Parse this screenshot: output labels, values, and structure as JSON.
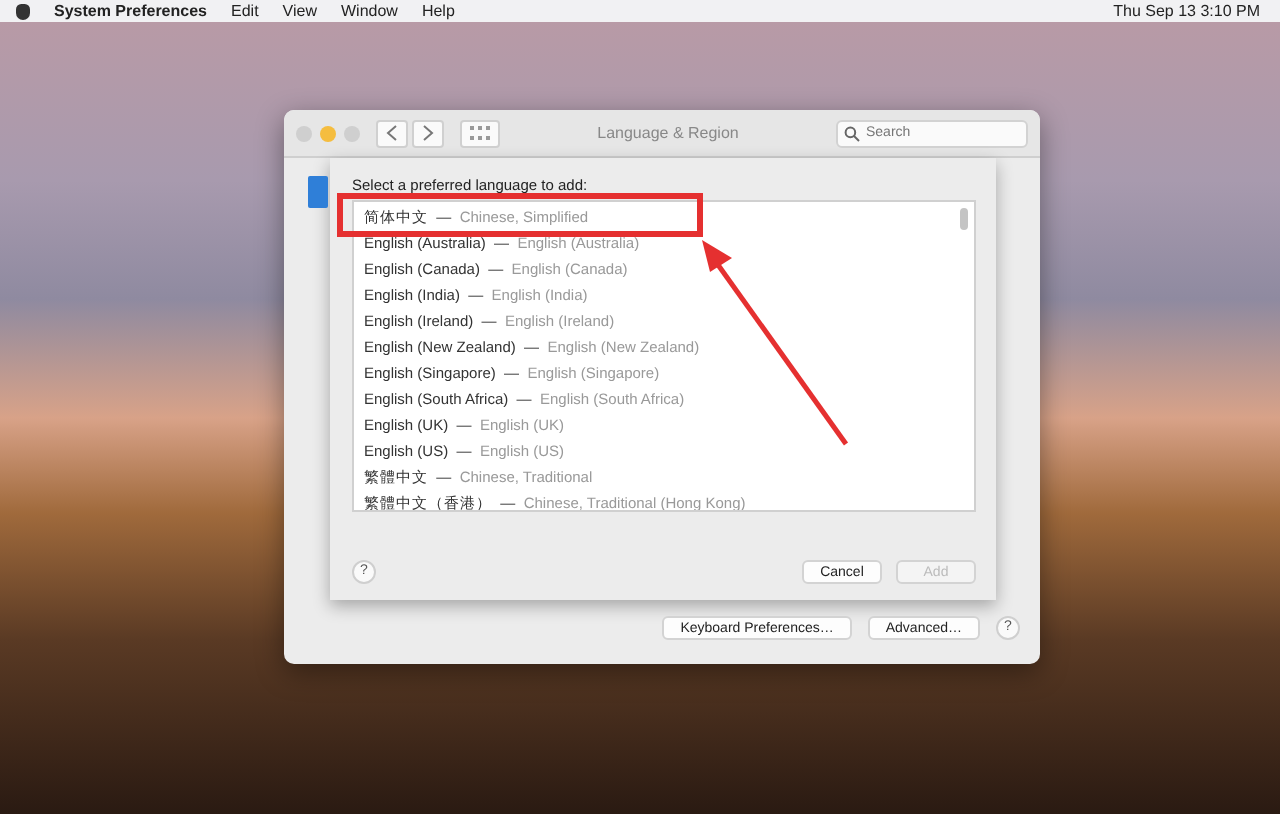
{
  "menu_bar": {
    "items": [
      {
        "label": "System Preferences",
        "kind": "app"
      },
      {
        "label": "Edit",
        "kind": "menu"
      },
      {
        "label": "View",
        "kind": "menu"
      },
      {
        "label": "Window",
        "kind": "menu"
      },
      {
        "label": "Help",
        "kind": "menu"
      }
    ],
    "clock": "Thu Sep 13  3:10 PM"
  },
  "window": {
    "title": "Language & Region",
    "search": {
      "placeholder": "Search"
    },
    "sheet": {
      "prompt": "Select a preferred language to add:",
      "languages": [
        {
          "native": "简体中文",
          "separator": "—",
          "english": "Chinese, Simplified"
        },
        {
          "native": "English (Australia)",
          "separator": "—",
          "english": "English (Australia)"
        },
        {
          "native": "English (Canada)",
          "separator": "—",
          "english": "English (Canada)"
        },
        {
          "native": "English (India)",
          "separator": "—",
          "english": "English (India)"
        },
        {
          "native": "English (Ireland)",
          "separator": "—",
          "english": "English (Ireland)"
        },
        {
          "native": "English (New Zealand)",
          "separator": "—",
          "english": "English (New Zealand)"
        },
        {
          "native": "English (Singapore)",
          "separator": "—",
          "english": "English (Singapore)"
        },
        {
          "native": "English (South Africa)",
          "separator": "—",
          "english": "English (South Africa)"
        },
        {
          "native": "English (UK)",
          "separator": "—",
          "english": "English (UK)"
        },
        {
          "native": "English (US)",
          "separator": "—",
          "english": "English (US)"
        },
        {
          "native": "繁體中文",
          "separator": "—",
          "english": "Chinese, Traditional"
        },
        {
          "native": "繁體中文（香港）",
          "separator": "—",
          "english": "Chinese, Traditional (Hong Kong)"
        }
      ],
      "help": "?",
      "buttons": [
        {
          "label": "Cancel",
          "disabled": false
        },
        {
          "label": "Add",
          "disabled": true
        }
      ]
    },
    "buttons": [
      {
        "label": "Keyboard Preferences…"
      },
      {
        "label": "Advanced…"
      }
    ],
    "help": "?"
  }
}
